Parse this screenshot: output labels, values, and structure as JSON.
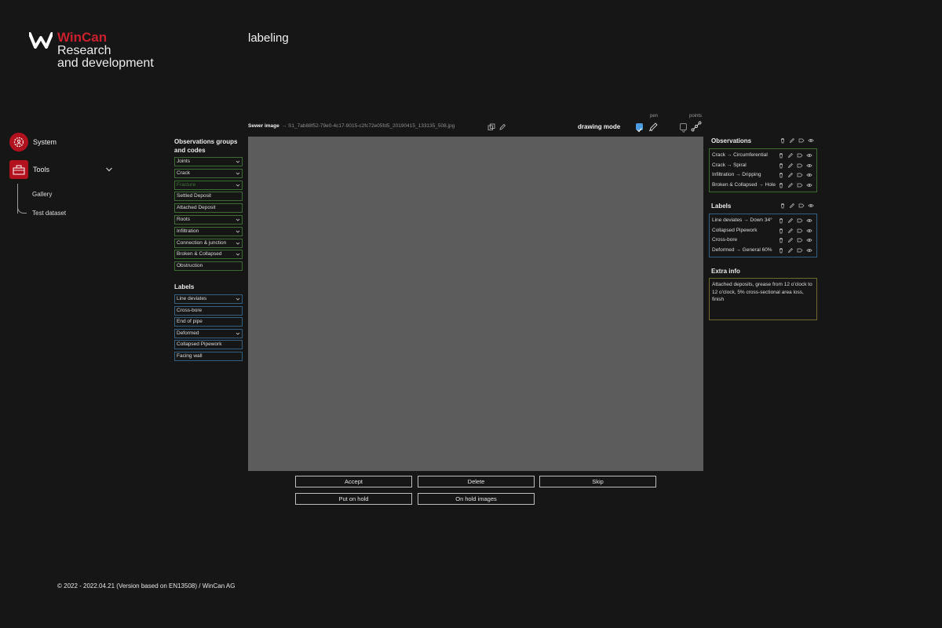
{
  "brand": {
    "name": "WinCan",
    "subtitle_line1": "Research",
    "subtitle_line2": "and development",
    "color": "#c8202c"
  },
  "page_title": "labeling",
  "sidebar": {
    "items": [
      {
        "label": "System",
        "icon": "gear-person-icon"
      },
      {
        "label": "Tools",
        "icon": "toolbox-icon"
      }
    ],
    "sub_items": [
      "Gallery",
      "Test dataset"
    ]
  },
  "observations_groups": {
    "title_line1": "Observations groups",
    "title_line2": "and codes",
    "items": [
      {
        "label": "Joints",
        "dropdown": true
      },
      {
        "label": "Crack",
        "dropdown": true
      },
      {
        "label": "Fracture",
        "dropdown": true,
        "disabled": true
      },
      {
        "label": "Settled Deposit",
        "dropdown": false
      },
      {
        "label": "Attached Deposit",
        "dropdown": false
      },
      {
        "label": "Roots",
        "dropdown": true
      },
      {
        "label": "Infiltration",
        "dropdown": true
      },
      {
        "label": "Connection & junction",
        "dropdown": true
      },
      {
        "label": "Broken & Collapsed",
        "dropdown": true
      },
      {
        "label": "Obstruction",
        "dropdown": false
      }
    ]
  },
  "labels_groups": {
    "title": "Labels",
    "items": [
      {
        "label": "Line deviates",
        "dropdown": true
      },
      {
        "label": "Cross-bore",
        "dropdown": false
      },
      {
        "label": "End of pipe",
        "dropdown": false
      },
      {
        "label": "Deformed",
        "dropdown": true
      },
      {
        "label": "Collapsed Pipework",
        "dropdown": false
      },
      {
        "label": "Facing wall",
        "dropdown": false
      }
    ]
  },
  "image_header": {
    "label": "Sewer image",
    "filename": "→ S1_7ab88f52-79e0-4c17-9015-c2fc72e05fd5_20190415_133135_508.jpg",
    "drawing_mode_label": "drawing mode",
    "pen_label": "pen",
    "points_label": "points",
    "pen_checked": true,
    "points_checked": false
  },
  "buttons": {
    "accept": "Accept",
    "delete": "Delete",
    "skip": "Skip",
    "put_on_hold": "Put on hold",
    "on_hold_images": "On hold images"
  },
  "right_panel": {
    "observations_title": "Observations",
    "observations": [
      "Crack → Circumferential",
      "Crack → Spiral",
      "Infiltration → Dripping",
      "Broken & Collapsed → Hole"
    ],
    "labels_title": "Labels",
    "labels": [
      "Line deviates → Down 34°",
      "Collapsed Pipework",
      "Cross-bore",
      "Deformed → General 60%"
    ],
    "extra_title": "Extra info",
    "extra_text": "Attached deposits, grease from 12 o'clock to 12 o'clock, 5% cross-sectional area loss, finish"
  },
  "footer": "© 2022 - 2022.04.21 (Version based on EN13508) / WinCan AG"
}
